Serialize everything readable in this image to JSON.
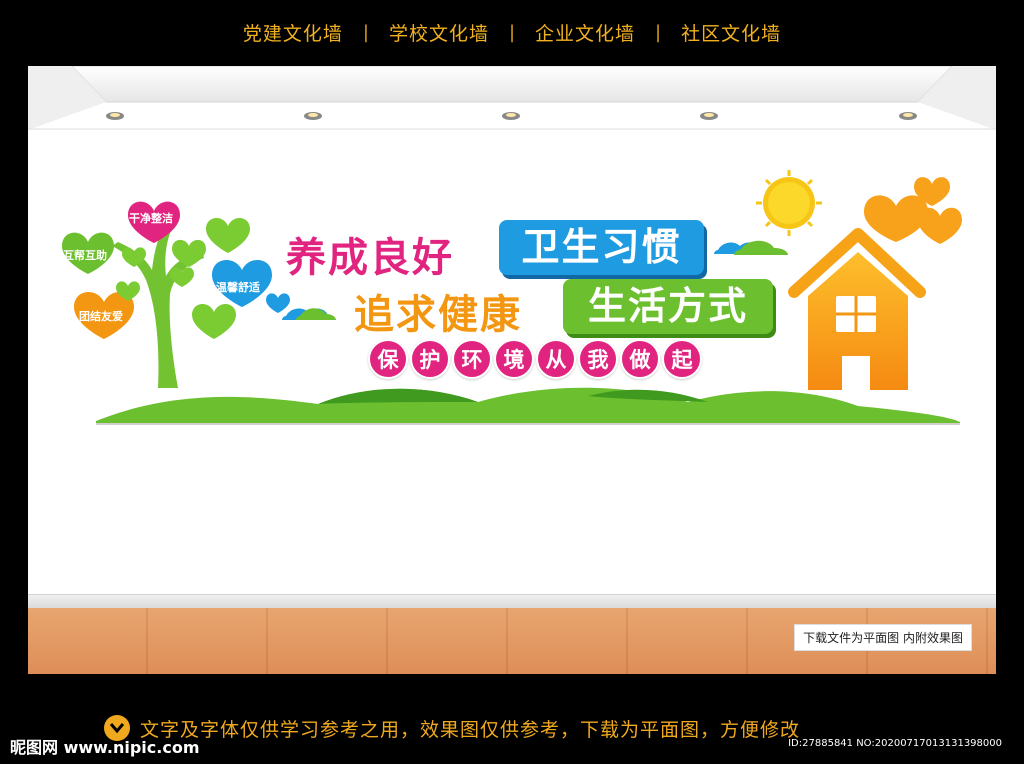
{
  "nav": {
    "items": [
      {
        "label": "党建文化墙"
      },
      {
        "label": "学校文化墙"
      },
      {
        "label": "企业文化墙"
      },
      {
        "label": "社区文化墙"
      }
    ],
    "separator": "|"
  },
  "wall": {
    "line1_left": "养成良好",
    "line1_box": "卫生习惯",
    "line2_left": "追求健康",
    "line2_box": "生活方式",
    "slogan": [
      "保",
      "护",
      "环",
      "境",
      "从",
      "我",
      "做",
      "起"
    ],
    "hearts": {
      "top": "干净整洁",
      "left": "互帮互助",
      "right": "温馨舒适",
      "bottom": "团结友爱"
    }
  },
  "floor_note": "下载文件为平面图  内附效果图",
  "footer": {
    "notice": "文字及字体仅供学习参考之用，效果图仅供参考，下载为平面图，方便修改",
    "brand": "昵图网 www.nipic.com",
    "id": "ID:27885841 NO:20200717013131398000"
  },
  "colors": {
    "nav_text": "#f2b11f",
    "pink": "#e1247f",
    "orange": "#f39611",
    "blue": "#1f9be2",
    "green": "#6cbf2f",
    "slogan_circles": [
      "#e1247f",
      "#e1247f",
      "#e1247f",
      "#e1247f",
      "#e1247f",
      "#e1247f",
      "#e1247f",
      "#e1247f"
    ]
  }
}
